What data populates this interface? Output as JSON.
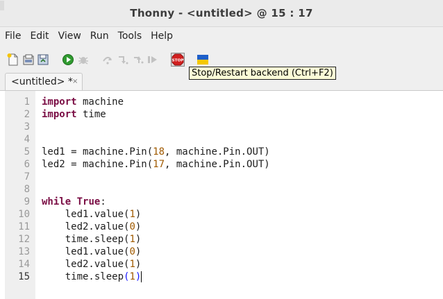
{
  "window": {
    "title": "Thonny  -  <untitled>  @  15 : 17"
  },
  "menu": [
    {
      "label": "File"
    },
    {
      "label": "Edit"
    },
    {
      "label": "View"
    },
    {
      "label": "Run"
    },
    {
      "label": "Tools"
    },
    {
      "label": "Help"
    }
  ],
  "toolbar": {
    "buttons": [
      {
        "name": "new-file",
        "icon": "new-file-icon"
      },
      {
        "name": "open-file",
        "icon": "open-folder-icon"
      },
      {
        "name": "save-file",
        "icon": "save-icon"
      },
      {
        "name": "run",
        "icon": "run-icon"
      },
      {
        "name": "debug",
        "icon": "debug-icon"
      },
      {
        "name": "step-over",
        "icon": "step-over-icon"
      },
      {
        "name": "step-into",
        "icon": "step-into-icon"
      },
      {
        "name": "step-out",
        "icon": "step-out-icon"
      },
      {
        "name": "resume",
        "icon": "resume-icon"
      },
      {
        "name": "stop",
        "icon": "stop-icon",
        "text": "STOP"
      },
      {
        "name": "support-ukraine",
        "icon": "ukraine-flag-icon"
      }
    ],
    "tooltip": "Stop/Restart backend (Ctrl+F2)"
  },
  "tabs": [
    {
      "label": "<untitled> *",
      "close": "×"
    }
  ],
  "editor": {
    "lines": [
      {
        "n": "1",
        "tokens": [
          {
            "t": "import",
            "k": "kw"
          },
          {
            "t": " machine",
            "k": ""
          }
        ]
      },
      {
        "n": "2",
        "tokens": [
          {
            "t": "import",
            "k": "kw"
          },
          {
            "t": " time",
            "k": ""
          }
        ]
      },
      {
        "n": "3",
        "tokens": []
      },
      {
        "n": "4",
        "tokens": []
      },
      {
        "n": "5",
        "tokens": [
          {
            "t": "led1 = machine.Pin(",
            "k": ""
          },
          {
            "t": "18",
            "k": "num"
          },
          {
            "t": ", machine.Pin.OUT)",
            "k": ""
          }
        ]
      },
      {
        "n": "6",
        "tokens": [
          {
            "t": "led2 = machine.Pin(",
            "k": ""
          },
          {
            "t": "17",
            "k": "num"
          },
          {
            "t": ", machine.Pin.OUT)",
            "k": ""
          }
        ]
      },
      {
        "n": "7",
        "tokens": []
      },
      {
        "n": "8",
        "tokens": []
      },
      {
        "n": "9",
        "tokens": [
          {
            "t": "while",
            "k": "kw"
          },
          {
            "t": " ",
            "k": ""
          },
          {
            "t": "True",
            "k": "kw"
          },
          {
            "t": ":",
            "k": ""
          }
        ]
      },
      {
        "n": "10",
        "tokens": [
          {
            "t": "    led1.value(",
            "k": ""
          },
          {
            "t": "1",
            "k": "num"
          },
          {
            "t": ")",
            "k": ""
          }
        ]
      },
      {
        "n": "11",
        "tokens": [
          {
            "t": "    led2.value(",
            "k": ""
          },
          {
            "t": "0",
            "k": "num"
          },
          {
            "t": ")",
            "k": ""
          }
        ]
      },
      {
        "n": "12",
        "tokens": [
          {
            "t": "    time.sleep(",
            "k": ""
          },
          {
            "t": "1",
            "k": "num"
          },
          {
            "t": ")",
            "k": ""
          }
        ]
      },
      {
        "n": "13",
        "tokens": [
          {
            "t": "    led1.value(",
            "k": ""
          },
          {
            "t": "0",
            "k": "num"
          },
          {
            "t": ")",
            "k": ""
          }
        ]
      },
      {
        "n": "14",
        "tokens": [
          {
            "t": "    led2.value(",
            "k": ""
          },
          {
            "t": "1",
            "k": "num"
          },
          {
            "t": ")",
            "k": ""
          }
        ]
      },
      {
        "n": "15",
        "current": true,
        "tokens": [
          {
            "t": "    time.sleep",
            "k": ""
          },
          {
            "t": "(",
            "k": "match"
          },
          {
            "t": "1",
            "k": "num"
          },
          {
            "t": ")",
            "k": "match"
          }
        ]
      }
    ]
  },
  "colors": {
    "keyword": "#7a0d44",
    "number": "#a05a00",
    "bracket_match": "#1414ff",
    "tooltip_bg": "#fbfbd6"
  }
}
